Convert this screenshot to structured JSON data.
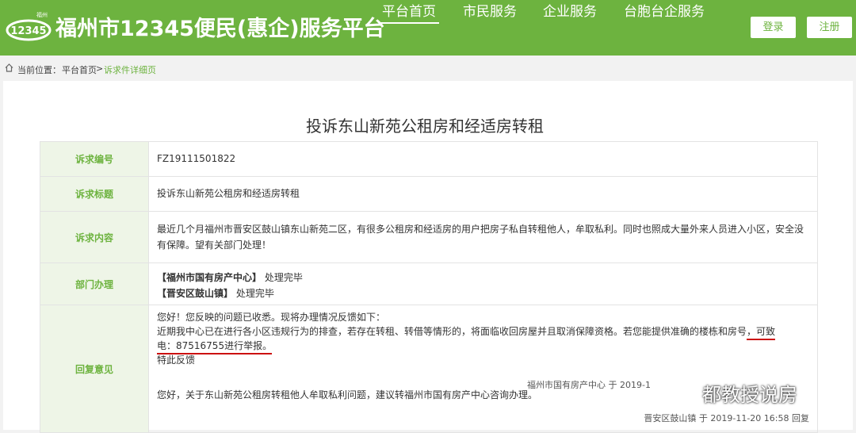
{
  "header": {
    "logo_text": "12345",
    "logo_small": "福州",
    "title": "福州市12345便民(惠企)服务平台",
    "nav": [
      "平台首页",
      "市民服务",
      "企业服务",
      "台胞台企服务"
    ],
    "login": "登录",
    "register": "注册"
  },
  "breadcrumb": {
    "label": "当前位置：",
    "home": "平台首页",
    "sep": ">",
    "current": "诉求件详细页"
  },
  "page": {
    "title": "投诉东山新苑公租房和经适房转租"
  },
  "rows": {
    "id_label": "诉求编号",
    "id_value": "FZ19111501822",
    "title_label": "诉求标题",
    "title_value": "投诉东山新苑公租房和经适房转租",
    "content_label": "诉求内容",
    "content_value": "最近几个月福州市晋安区鼓山镇东山新苑二区，有很多公租房和经适房的用户把房子私自转租他人，牟取私利。同时也照成大量外来人员进入小区，安全没有保障。望有关部门处理！",
    "dept_label": "部门办理",
    "dept1_name": "【福州市国有房产中心】",
    "dept1_status": "处理完毕",
    "dept2_name": "【晋安区鼓山镇】",
    "dept2_status": "处理完毕",
    "reply_label": "回复意见",
    "reply_line1": "您好！您反映的问题已收悉。现将办理情况反馈如下：",
    "reply_line2a": "近期我中心已在进行各小区违规行为的排查，若存在转租、转借等情形的，将面临收回房屋并且取消保障资格。若您能提供准确的楼栋和房号",
    "reply_line2b": "，可致",
    "reply_line3": "电：87516755进行举报。",
    "reply_line4": "特此反馈",
    "reply_sig1": "福州市国有房产中心 于 2019-1",
    "reply_line5": "您好，关于东山新苑公租房转租他人牟取私利问题，建议转福州市国有房产中心咨询办理。",
    "reply_sig2": "晋安区鼓山镇 于 2019-11-20 16:58 回复"
  },
  "watermark": "都教授说房",
  "colors": {
    "brand": "#6db33f",
    "label_bg": "#eef5e7",
    "underline": "#cc1111"
  }
}
